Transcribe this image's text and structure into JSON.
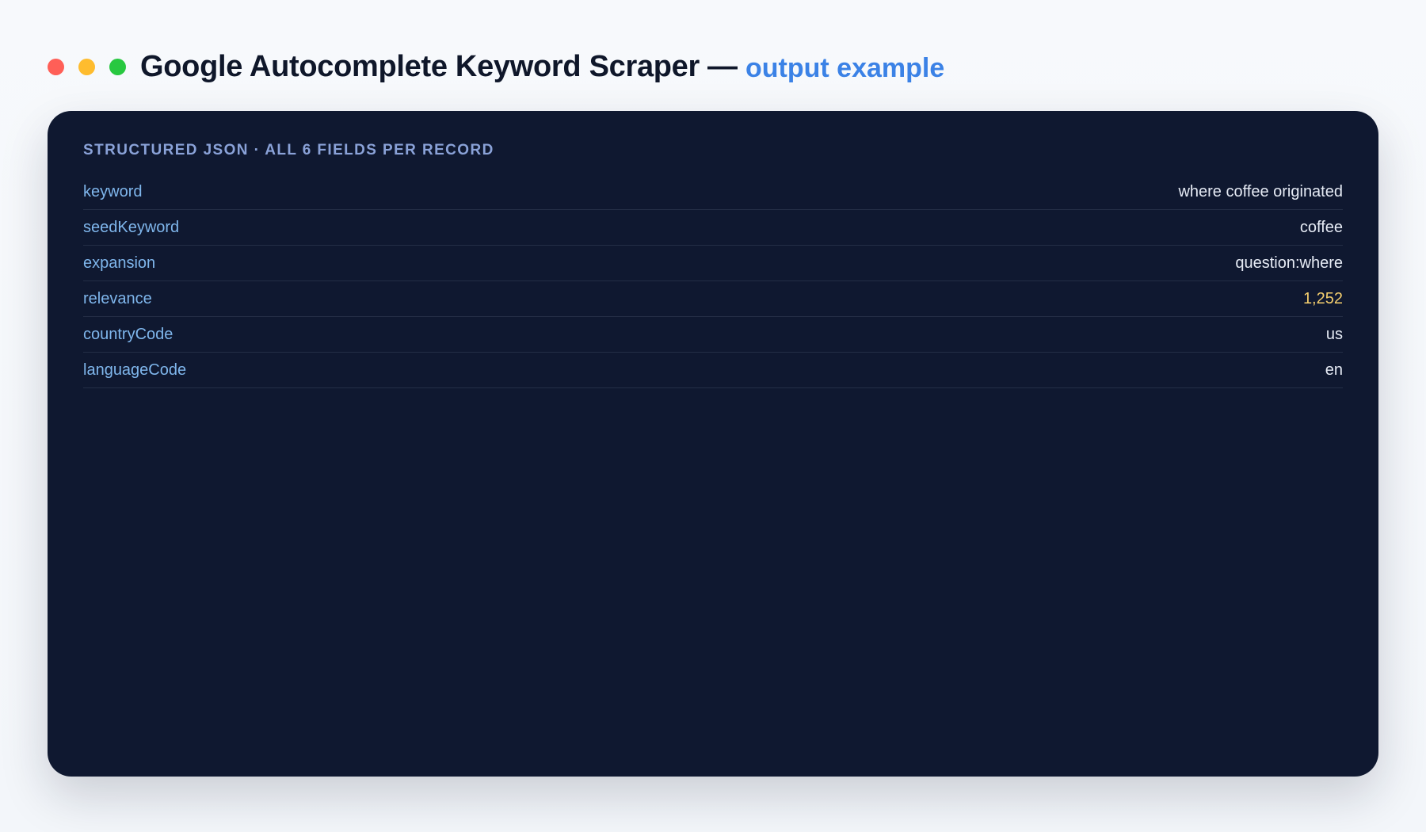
{
  "window": {
    "title": "Google Autocomplete Keyword Scraper",
    "separator": "—",
    "subtitle": "output example",
    "dots": [
      {
        "name": "close",
        "color": "#ff5f57"
      },
      {
        "name": "minimize",
        "color": "#febc2e"
      },
      {
        "name": "maximize",
        "color": "#28c840"
      }
    ]
  },
  "card": {
    "heading": "STRUCTURED JSON · ALL 6 FIELDS PER RECORD",
    "fields": [
      {
        "key": "keyword",
        "value": "where coffee originated",
        "kind": "string"
      },
      {
        "key": "seedKeyword",
        "value": "coffee",
        "kind": "string"
      },
      {
        "key": "expansion",
        "value": "question:where",
        "kind": "string"
      },
      {
        "key": "relevance",
        "value": "1,252",
        "kind": "number"
      },
      {
        "key": "countryCode",
        "value": "us",
        "kind": "string"
      },
      {
        "key": "languageCode",
        "value": "en",
        "kind": "string"
      }
    ]
  },
  "colors": {
    "page_bg": "#f3f6fa",
    "title": "#0f172a",
    "accent": "#3b82e6",
    "card_bg": "#0f1830",
    "heading": "#8aa2d8",
    "key": "#7fb6ec",
    "string_value": "#e6ebf5",
    "number_value": "#f5cf6e"
  }
}
